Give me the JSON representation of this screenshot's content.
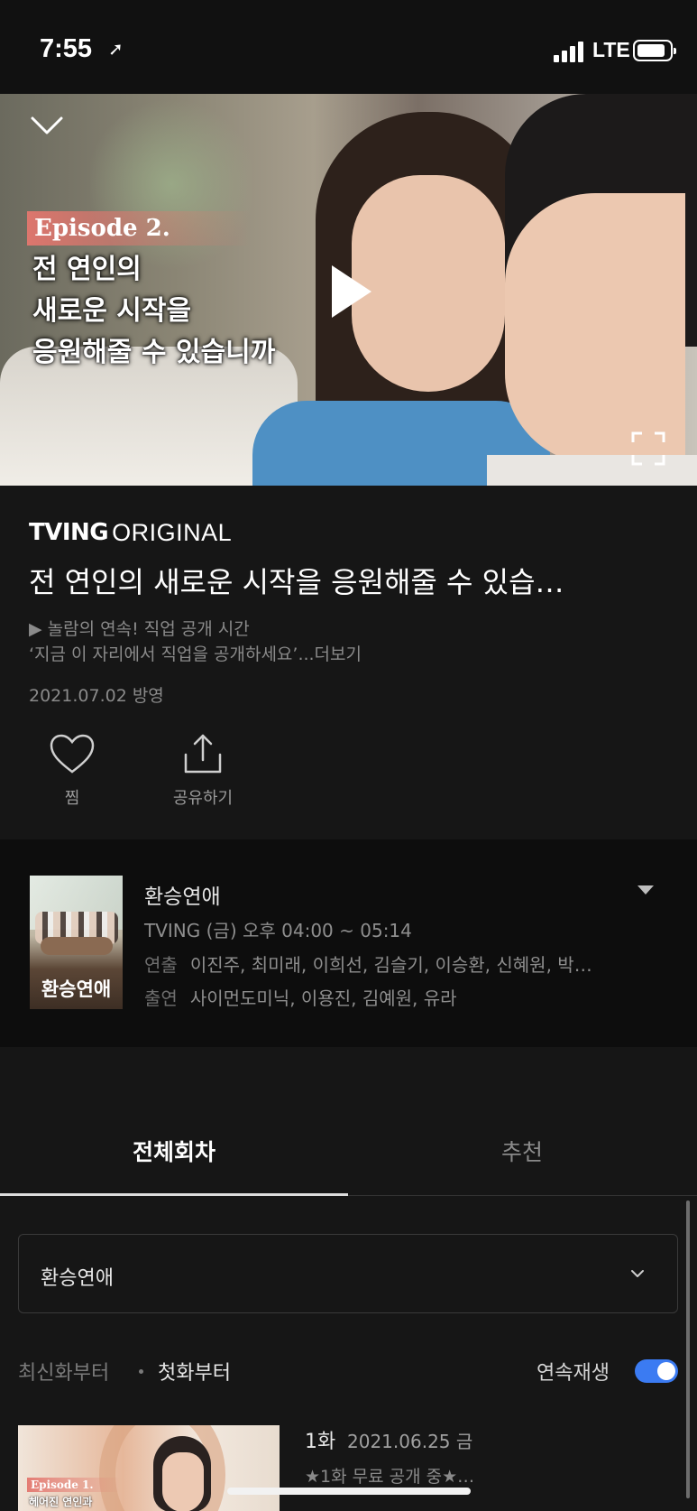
{
  "status_bar": {
    "time": "7:55",
    "network": "LTE"
  },
  "player": {
    "episode_tag": "Episode 2.",
    "overlay_title_lines": [
      "전 연인의",
      "새로운 시작을",
      "응원해줄 수 있습니까"
    ]
  },
  "info": {
    "brand_bold": "TVING",
    "brand_light": "ORIGINAL",
    "title": "전 연인의 새로운 시작을 응원해줄 수 있습…",
    "description_line1": "▶ 놀람의 연속! 직업 공개 시간",
    "description_line2": "‘지금 이 자리에서 직업을 공개하세요’...더보기",
    "air_date": "2021.07.02 방영",
    "like_label": "찜",
    "share_label": "공유하기"
  },
  "program": {
    "poster_title": "환승연애",
    "name": "환승연애",
    "schedule": "TVING (금) 오후 04:00 ~ 05:14",
    "director_key": "연출",
    "director_value": "이진주, 최미래, 이희선, 김슬기, 이승환, 신혜원, 박…",
    "cast_key": "출연",
    "cast_value": "사이먼도미닉, 이용진, 김예원, 유라"
  },
  "tabs": [
    {
      "label": "전체회차"
    },
    {
      "label": "추천"
    }
  ],
  "season_select": {
    "value": "환승연애"
  },
  "sort": {
    "newest": "최신화부터",
    "first": "첫화부터",
    "autoplay_label": "연속재생",
    "autoplay_on": true
  },
  "episodes": [
    {
      "number": "1화",
      "date": "2021.06.25 금",
      "subtitle": "★1화 무료 공개 중★…",
      "thumb_tag": "Episode 1.",
      "thumb_text": "헤어진 연인과"
    }
  ],
  "colors": {
    "accent": "#3b7bf2",
    "episode_tag": "#e3766e",
    "background": "#161616"
  }
}
